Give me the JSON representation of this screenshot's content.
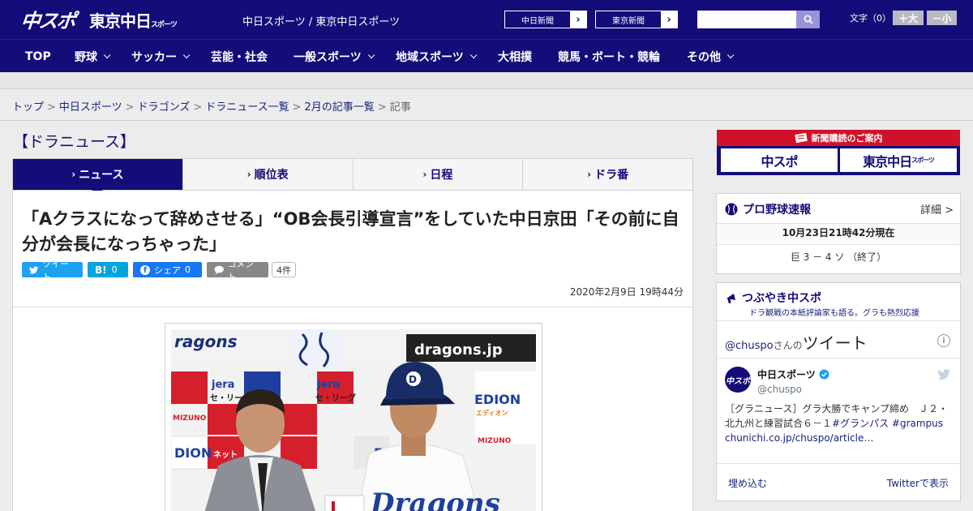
{
  "header": {
    "logo_primary": "中スポ",
    "logo_secondary": "東京中日",
    "logo_secondary_small": "スポーツ",
    "site_names": "中日スポーツ / 東京中日スポーツ",
    "papers": [
      {
        "label": "中日新聞",
        "arrow": "›"
      },
      {
        "label": "東京新聞",
        "arrow": "›"
      }
    ],
    "search": {
      "placeholder": "",
      "value": ""
    },
    "font_size_label": "文字（0）",
    "font_larger": "＋大",
    "font_smaller": "－小"
  },
  "nav": [
    {
      "label": "TOP",
      "has_menu": false
    },
    {
      "label": "野球",
      "has_menu": true
    },
    {
      "label": "サッカー",
      "has_menu": true
    },
    {
      "label": "芸能・社会",
      "has_menu": false
    },
    {
      "label": "一般スポーツ",
      "has_menu": true
    },
    {
      "label": "地域スポーツ",
      "has_menu": true
    },
    {
      "label": "大相撲",
      "has_menu": false
    },
    {
      "label": "競馬・ボート・競輪",
      "has_menu": false
    },
    {
      "label": "その他",
      "has_menu": true
    }
  ],
  "breadcrumb": {
    "items": [
      "トップ",
      "中日スポーツ",
      "ドラゴンズ",
      "ドラニュース一覧",
      "2月の記事一覧"
    ],
    "current": "記事",
    "separator": ">"
  },
  "section_title": "【ドラニュース】",
  "tabs": [
    {
      "label": "ニュース",
      "active": true
    },
    {
      "label": "順位表",
      "active": false
    },
    {
      "label": "日程",
      "active": false
    },
    {
      "label": "ドラ番",
      "active": false
    }
  ],
  "article": {
    "headline": "「Aクラスになって辞めさせる」“OB会長引導宣言”をしていた中日京田「その前に自分が会長になっちゃった」",
    "share": {
      "tweet": "ツイート",
      "hatena_mark": "B!",
      "hatena_count": "0",
      "facebook": "シェア",
      "facebook_count": "0",
      "comment": "コメント",
      "comment_count": "4件"
    },
    "date": "2020年2月9日 19時44分",
    "photo": {
      "backdrop_texts": [
        "ragons",
        "dragons.jp",
        "jera",
        "セ・リーグ",
        "MIZUNO",
        "ネット",
        "EDION",
        "DION",
        "エディオン"
      ],
      "cap_mark": "D"
    }
  },
  "sidebar": {
    "subscription": {
      "title": "新聞購読のご案内",
      "box1": "中スポ",
      "box2": "東京中日",
      "box2_small": "スポーツ"
    },
    "live_score": {
      "title": "プロ野球速報",
      "detail_link": "詳細 >",
      "updated": "10月23日21時42分現在",
      "game": "巨 3 － 4 ソ （終了）"
    },
    "tweets": {
      "title": "つぶやき中スポ",
      "subtitle": "ドラ観戦の本紙評論家も語る。グラも熱烈応援",
      "handle_prefix": "@chuspo",
      "handle_suffix": "さんの",
      "tweets_word": "ツイート",
      "account_name": "中日スポーツ",
      "account_handle": "@chuspo",
      "tweet_text": "［グラニュース］グラ大勝でキャンプ締め　Ｊ２・北九州と練習試合６－１",
      "hashtag1": "#グランパス",
      "hashtag2": "#grampus",
      "link": "chunichi.co.jp/chuspo/article…",
      "embed": "埋め込む",
      "view_on": "Twitterで表示"
    }
  },
  "colors": {
    "brand_navy": "#140c78",
    "subscription_red": "#d0112b",
    "twitter_blue": "#1da1f2",
    "facebook_blue": "#1877f2",
    "hatena_blue": "#00a4de"
  }
}
